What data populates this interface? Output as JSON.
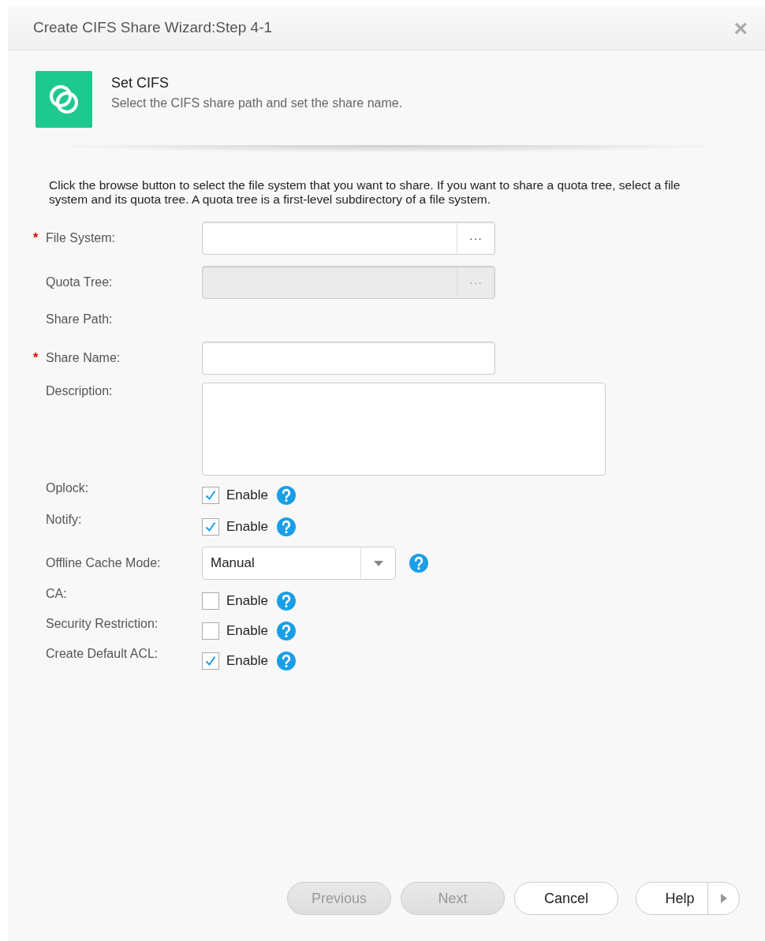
{
  "window": {
    "title": "Create CIFS Share Wizard:Step 4-1",
    "close": "×"
  },
  "step": {
    "title": "Set CIFS",
    "subtitle": "Select the CIFS share path and set the share name."
  },
  "instructions": "Click the browse button to select the file system that you want to share. If you want to share a quota tree, select a file system and its quota tree. A quota tree is a first-level subdirectory of a file system.",
  "fields": [
    {
      "kind": "browse",
      "label": "File System:",
      "required_mark": "*",
      "disabled": false,
      "button": "···"
    },
    {
      "kind": "browse",
      "label": "Quota Tree:",
      "disabled": true,
      "button": "···"
    },
    {
      "kind": "static",
      "label": "Share Path:"
    },
    {
      "kind": "text",
      "label": "Share Name:",
      "required_mark": "*"
    },
    {
      "kind": "textarea",
      "label": "Description:"
    },
    {
      "kind": "checkbox",
      "label": "Oplock:",
      "option": "Enable",
      "checked": true
    },
    {
      "kind": "checkbox",
      "label": "Notify:",
      "option": "Enable",
      "checked": true
    },
    {
      "kind": "select",
      "label": "Offline Cache Mode:",
      "value": "Manual"
    },
    {
      "kind": "checkbox",
      "label": "CA:",
      "option": "Enable",
      "checked": false
    },
    {
      "kind": "checkbox",
      "label": "Security Restriction:",
      "option": "Enable",
      "checked": false
    },
    {
      "kind": "checkbox",
      "label": "Create Default ACL:",
      "option": "Enable",
      "checked": true
    }
  ],
  "buttons": [
    {
      "label": "Previous",
      "disabled": true
    },
    {
      "label": "Next",
      "disabled": true
    },
    {
      "label": "Cancel",
      "disabled": false
    }
  ],
  "help": {
    "label": "Help"
  }
}
